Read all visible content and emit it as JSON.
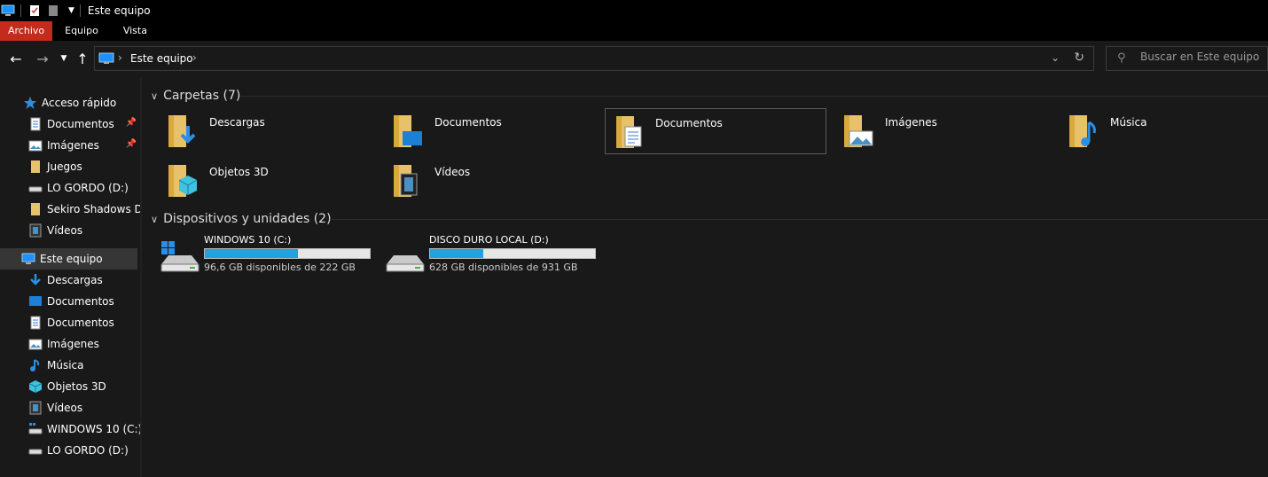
{
  "window": {
    "title": "Este equipo"
  },
  "ribbon": {
    "tabs": [
      {
        "label": "Archivo",
        "active": true
      },
      {
        "label": "Equipo"
      },
      {
        "label": "Vista"
      }
    ]
  },
  "address": {
    "crumb": "Este equipo"
  },
  "search": {
    "placeholder": "Buscar en Este equipo"
  },
  "sidebar": {
    "items": [
      {
        "label": "Acceso rápido",
        "icon": "star-icon"
      },
      {
        "label": "Documentos",
        "icon": "documents-icon",
        "pinned": true
      },
      {
        "label": "Imágenes",
        "icon": "pictures-icon",
        "pinned": true
      },
      {
        "label": "Juegos",
        "icon": "folder-icon"
      },
      {
        "label": "LO GORDO (D:)",
        "icon": "drive-icon"
      },
      {
        "label": "Sekiro Shadows Die",
        "icon": "folder-icon"
      },
      {
        "label": "Vídeos",
        "icon": "videos-icon"
      },
      {
        "label": "Este equipo",
        "icon": "computer-icon",
        "selected": true
      },
      {
        "label": "Descargas",
        "icon": "download-icon"
      },
      {
        "label": "Documentos",
        "icon": "desktop-icon"
      },
      {
        "label": "Documentos",
        "icon": "documents-icon"
      },
      {
        "label": "Imágenes",
        "icon": "pictures-icon"
      },
      {
        "label": "Música",
        "icon": "music-icon"
      },
      {
        "label": "Objetos 3D",
        "icon": "cube-icon"
      },
      {
        "label": "Vídeos",
        "icon": "videos-icon"
      },
      {
        "label": "WINDOWS 10 (C:)",
        "icon": "windows-drive-icon"
      },
      {
        "label": "LO GORDO (D:)",
        "icon": "drive-icon"
      }
    ]
  },
  "folders": {
    "header": "Carpetas (7)",
    "items": [
      {
        "label": "Descargas",
        "icon": "download-folder-icon"
      },
      {
        "label": "Documentos",
        "icon": "desktop-folder-icon"
      },
      {
        "label": "Documentos",
        "icon": "documents-folder-icon",
        "highlighted": true
      },
      {
        "label": "Imágenes",
        "icon": "pictures-folder-icon"
      },
      {
        "label": "Música",
        "icon": "music-folder-icon"
      },
      {
        "label": "Objetos 3D",
        "icon": "3d-objects-folder-icon"
      },
      {
        "label": "Vídeos",
        "icon": "videos-folder-icon"
      }
    ]
  },
  "devices": {
    "header": "Dispositivos y unidades (2)",
    "items": [
      {
        "label": "WINDOWS 10 (C:)",
        "free": "96,6 GB disponibles de 222 GB",
        "used_fraction": 0.565,
        "icon": "windows-drive-icon"
      },
      {
        "label": "DISCO DURO LOCAL (D:)",
        "free": "628 GB disponibles de 931 GB",
        "used_fraction": 0.325,
        "icon": "drive-icon"
      }
    ]
  },
  "colors": {
    "accent": "#c42b1c",
    "bar_fill": "#26a0da",
    "folder": "#e8c26b"
  }
}
